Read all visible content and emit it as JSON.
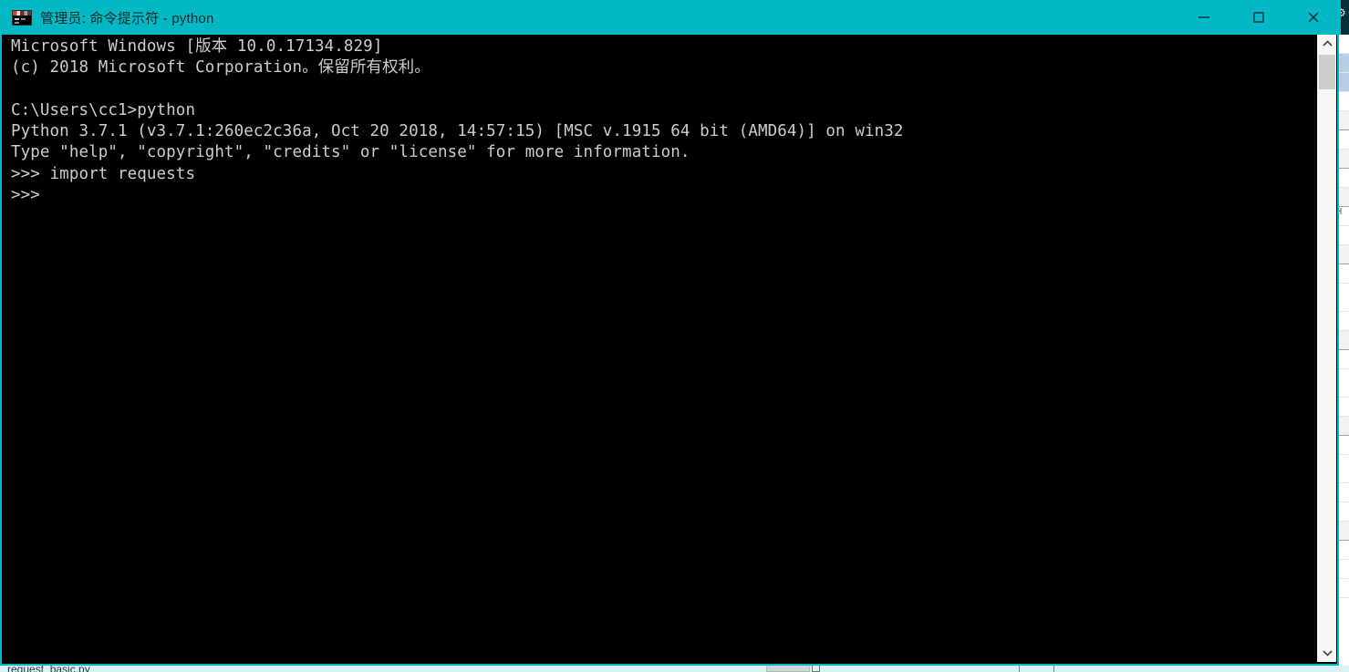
{
  "window": {
    "title": "管理员: 命令提示符 - python",
    "icon": "console-window-icon",
    "accent_color": "#02b8c4",
    "background_color": "#000000",
    "text_color": "#ccccc8",
    "controls": {
      "minimize_label": "最小化",
      "maximize_label": "最大化",
      "close_label": "关闭"
    }
  },
  "console": {
    "lines": [
      "Microsoft Windows [版本 10.0.17134.829]",
      "(c) 2018 Microsoft Corporation。保留所有权利。",
      "",
      "C:\\Users\\cc1>python",
      "Python 3.7.1 (v3.7.1:260ec2c36a, Oct 20 2018, 14:57:15) [MSC v.1915 64 bit (AMD64)] on win32",
      "Type \"help\", \"copyright\", \"credits\" or \"license\" for more information.",
      ">>> import requests",
      ">>>"
    ],
    "text": "Microsoft Windows [版本 10.0.17134.829]\n(c) 2018 Microsoft Corporation。保留所有权利。\n\nC:\\Users\\cc1>python\nPython 3.7.1 (v3.7.1:260ec2c36a, Oct 20 2018, 14:57:15) [MSC v.1915 64 bit (AMD64)] on win32\nType \"help\", \"copyright\", \"credits\" or \"license\" for more information.\n>>> import requests\n>>> ",
    "os_name": "Microsoft Windows",
    "os_version": "10.0.17134.829",
    "copyright": "(c) 2018 Microsoft Corporation。保留所有权利。",
    "prompt_path": "C:\\Users\\cc1",
    "command": "python",
    "python_version": "3.7.1",
    "python_build": "v3.7.1:260ec2c36a, Oct 20 2018, 14:57:15",
    "compiler": "MSC v.1915 64 bit (AMD64)",
    "platform": "win32",
    "last_statement": "import requests",
    "current_prompt": ">>>"
  },
  "scrollbar": {
    "up_arrow": "chevron-up-icon",
    "down_arrow": "chevron-down-icon",
    "thumb_position_percent": 0
  },
  "background": {
    "bottom_file_label": "request_basic.py"
  }
}
